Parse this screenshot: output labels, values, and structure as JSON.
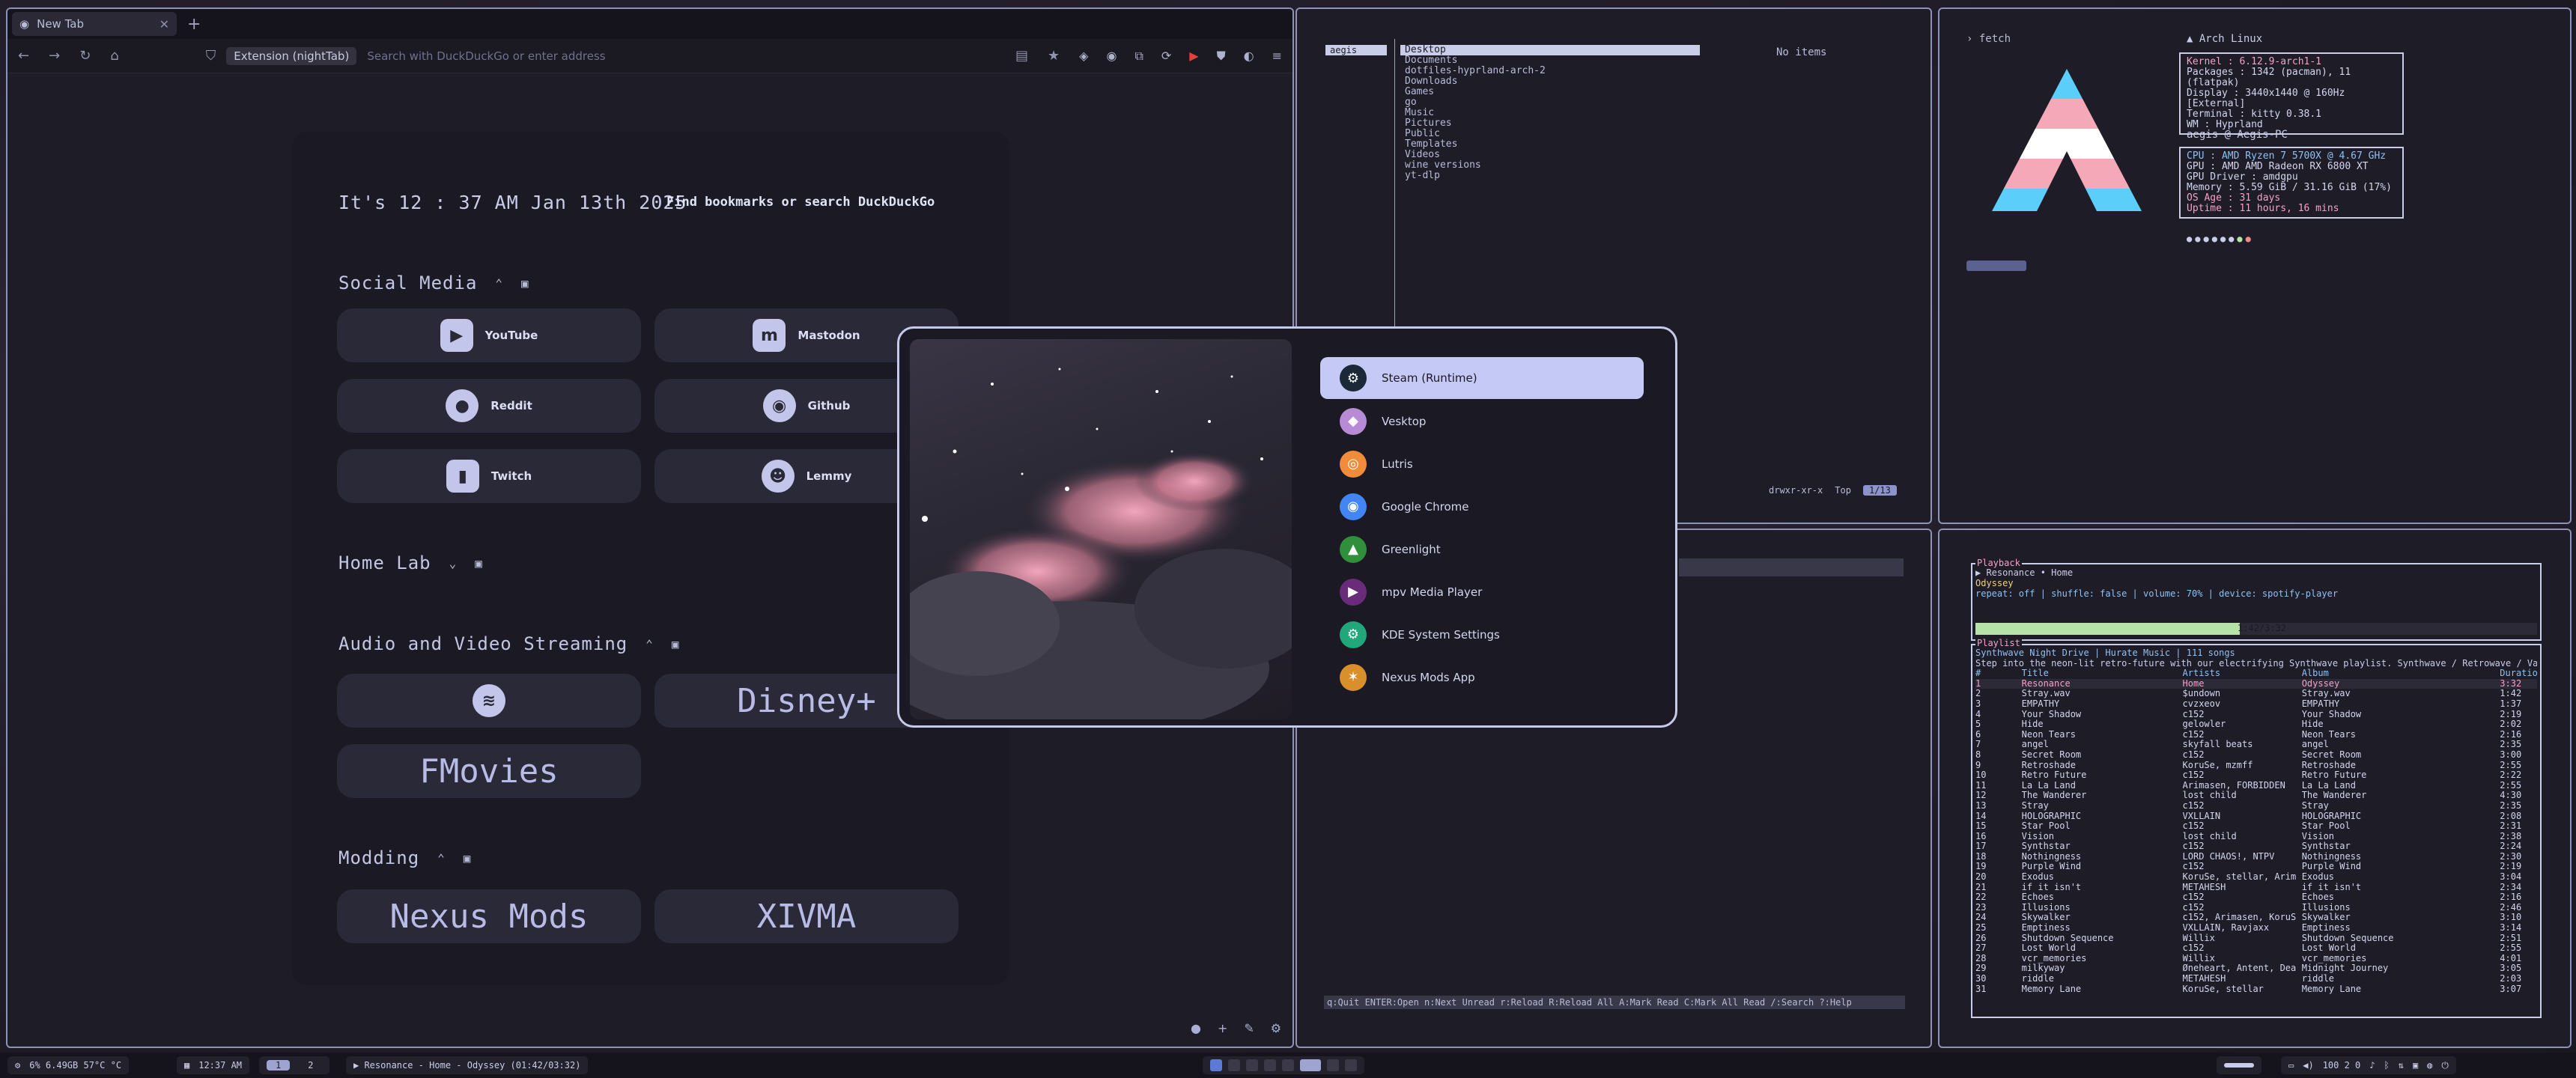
{
  "browser": {
    "tab_title": "New Tab",
    "extension_chip": "Extension (nightTab)",
    "url_placeholder": "Search with DuckDuckGo or enter address"
  },
  "newtab": {
    "clock": "It's 12 : 37 AM Jan 13th 2025",
    "search_link": "Find bookmarks or search DuckDuckGo",
    "groups": [
      {
        "title": "Social Media",
        "tiles": [
          "YouTube",
          "Mastodon",
          "Reddit",
          "Github",
          "Twitch",
          "Lemmy"
        ]
      },
      {
        "title": "Home Lab",
        "tiles": []
      },
      {
        "title": "Audio and Video Streaming",
        "tiles": [
          "",
          "Disney+",
          "FMovies"
        ]
      },
      {
        "title": "Modding",
        "tiles": [
          "Nexus Mods",
          "XIVMA"
        ]
      }
    ]
  },
  "file_manager": {
    "left": [
      "aegis"
    ],
    "items": [
      "Desktop",
      "Documents",
      "dotfiles-hyprland-arch-2",
      "Downloads",
      "Games",
      "go",
      "Music",
      "Pictures",
      "Public",
      "Templates",
      "Videos",
      "wine versions",
      "yt-dlp"
    ],
    "empty_text": "No items",
    "perms": "drwxr-xr-x",
    "position": "Top",
    "page": "1/13"
  },
  "rss": {
    "help": "q:Quit ENTER:Open n:Next Unread r:Reload R:Reload All A:Mark Read C:Mark All Read /:Search ?:Help"
  },
  "fetch": {
    "prompt": "› fetch",
    "os": "Arch Linux",
    "kernel": "Kernel : 6.12.9-arch1-1",
    "packages": "Packages : 1342 (pacman), 11 (flatpak)",
    "display": "Display : 3440x1440 @ 160Hz [External]",
    "terminal": "Terminal : kitty 0.38.1",
    "wm": "WM : Hyprland",
    "user": "aegis @ Aegis-PC",
    "cpu": "CPU : AMD Ryzen 7 5700X @ 4.67 GHz",
    "gpu": "GPU : AMD AMD Radeon RX 6800 XT",
    "gpu_driver": "GPU Driver : amdgpu",
    "memory": "Memory : 5.59 GiB / 31.16 GiB (17%)",
    "os_age": "OS Age : 31 days",
    "uptime": "Uptime : 11 hours, 16 mins"
  },
  "music": {
    "playback_label": "Playback",
    "now_playing": "▶ Resonance • Home",
    "album": "Odyssey",
    "status": "repeat: off | shuffle: false | volume: 70% | device: spotify-player",
    "progress": 0.47,
    "progress_text": "1:42/3:32",
    "playlist_label": "Playlist",
    "playlist_name": "Synthwave Night Drive | Hurate Music | 111 songs",
    "playlist_desc": "Step into the neon-lit retro-future with our electrifying Synthwave playlist. Synthwave / Retrowave / Vaporw",
    "headers": [
      "#",
      "Title",
      "Artists",
      "Album",
      "Duratio"
    ],
    "tracks": [
      [
        "1",
        "Resonance",
        "Home",
        "Odyssey",
        "3:32"
      ],
      [
        "2",
        "Stray.wav",
        "$undown",
        "Stray.wav",
        "1:42"
      ],
      [
        "3",
        "EMPATHY",
        "cvzxeov",
        "EMPATHY",
        "1:37"
      ],
      [
        "4",
        "Your Shadow",
        "c152",
        "Your Shadow",
        "2:19"
      ],
      [
        "5",
        "Hide",
        "gelowler",
        "Hide",
        "2:02"
      ],
      [
        "6",
        "Neon Tears",
        "c152",
        "Neon Tears",
        "2:16"
      ],
      [
        "7",
        "angel",
        "skyfall beats",
        "angel",
        "2:35"
      ],
      [
        "8",
        "Secret Room",
        "c152",
        "Secret Room",
        "3:00"
      ],
      [
        "9",
        "Retroshade",
        "KoruSe, mzmff",
        "Retroshade",
        "2:55"
      ],
      [
        "10",
        "Retro Future",
        "c152",
        "Retro Future",
        "2:22"
      ],
      [
        "11",
        "La La Land",
        "Arimasen, FORBIDDEN",
        "La La Land",
        "2:55"
      ],
      [
        "12",
        "The Wanderer",
        "lost child",
        "The Wanderer",
        "4:30"
      ],
      [
        "13",
        "Stray",
        "c152",
        "Stray",
        "2:35"
      ],
      [
        "14",
        "HOLOGRAPHIC",
        "VXLLAIN",
        "HOLOGRAPHIC",
        "2:08"
      ],
      [
        "15",
        "Star Pool",
        "c152",
        "Star Pool",
        "2:31"
      ],
      [
        "16",
        "Vision",
        "lost child",
        "Vision",
        "2:38"
      ],
      [
        "17",
        "Synthstar",
        "c152",
        "Synthstar",
        "2:24"
      ],
      [
        "18",
        "Nothingness",
        "LORD CHAOS!, NTPV",
        "Nothingness",
        "2:30"
      ],
      [
        "19",
        "Purple Wind",
        "c152",
        "Purple Wind",
        "2:19"
      ],
      [
        "20",
        "Exodus",
        "KoruSe, stellar, Arim",
        "Exodus",
        "3:04"
      ],
      [
        "21",
        "if it isn't",
        "METAHESH",
        "if it isn't",
        "2:34"
      ],
      [
        "22",
        "Echoes",
        "c152",
        "Echoes",
        "2:16"
      ],
      [
        "23",
        "Illusions",
        "c152",
        "Illusions",
        "2:46"
      ],
      [
        "24",
        "Skywalker",
        "c152, Arimasen, KoruS",
        "Skywalker",
        "3:10"
      ],
      [
        "25",
        "Emptiness",
        "VXLLAIN, Ravjaxx",
        "Emptiness",
        "3:14"
      ],
      [
        "26",
        "Shutdown Sequence",
        "Willix",
        "Shutdown Sequence",
        "2:51"
      ],
      [
        "27",
        "Lost World",
        "c152",
        "Lost World",
        "2:55"
      ],
      [
        "28",
        "vcr_memories",
        "Willix",
        "vcr_memories",
        "4:01"
      ],
      [
        "29",
        "milkyway",
        "Øneheart, Antent, Dea",
        "Midnight Journey",
        "3:05"
      ],
      [
        "30",
        "riddle",
        "METAHESH",
        "riddle",
        "2:03"
      ],
      [
        "31",
        "Memory Lane",
        "KoruSe, stellar",
        "Memory Lane",
        "3:07"
      ]
    ]
  },
  "launcher": {
    "apps": [
      {
        "name": "Steam (Runtime)",
        "icon": "steam-icon",
        "color": "#1b2838"
      },
      {
        "name": "Vesktop",
        "icon": "vesktop-icon",
        "color": "#b78bd6"
      },
      {
        "name": "Lutris",
        "icon": "lutris-icon",
        "color": "#f08c3a"
      },
      {
        "name": "Google Chrome",
        "icon": "chrome-icon",
        "color": "#4285f4"
      },
      {
        "name": "Greenlight",
        "icon": "greenlight-icon",
        "color": "#2f8f3a"
      },
      {
        "name": "mpv Media Player",
        "icon": "mpv-icon",
        "color": "#6b2b7b"
      },
      {
        "name": "KDE System Settings",
        "icon": "kde-settings-icon",
        "color": "#20a87a"
      },
      {
        "name": "Nexus Mods App",
        "icon": "nexus-icon",
        "color": "#d98f2c"
      }
    ]
  },
  "taskbar": {
    "sysinfo": "6%  6.49GB  57°C  °C",
    "clock": "12:37 AM",
    "workspaces": [
      "1",
      "2"
    ],
    "media": "▶ Resonance - Home - Odyssey (01:42/03:32)",
    "right": "100  2  0"
  }
}
